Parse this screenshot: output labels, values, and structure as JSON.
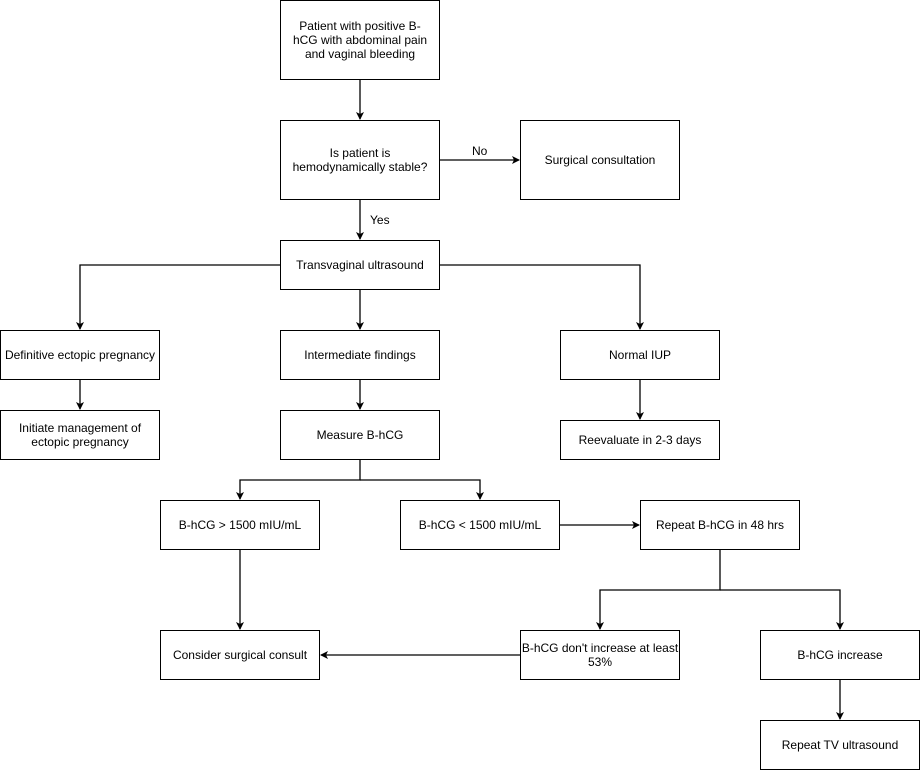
{
  "diagram": {
    "nodes": [
      {
        "id": "n1",
        "label": "Patient with positive B-hCG with abdominal pain and vaginal bleeding"
      },
      {
        "id": "n2",
        "label": "Is patient is hemodynamically stable?"
      },
      {
        "id": "n3",
        "label": "Surgical consultation"
      },
      {
        "id": "n4",
        "label": "Transvaginal ultrasound"
      },
      {
        "id": "n5",
        "label": "Definitive ectopic pregnancy"
      },
      {
        "id": "n6",
        "label": "Intermediate findings"
      },
      {
        "id": "n7",
        "label": "Normal IUP"
      },
      {
        "id": "n8",
        "label": "Initiate management of ectopic pregnancy"
      },
      {
        "id": "n9",
        "label": "Measure B-hCG"
      },
      {
        "id": "n10",
        "label": "Reevaluate in 2-3 days"
      },
      {
        "id": "n11",
        "label": "B-hCG > 1500 mIU/mL"
      },
      {
        "id": "n12",
        "label": "B-hCG < 1500 mIU/mL"
      },
      {
        "id": "n13",
        "label": "Repeat B-hCG in 48 hrs"
      },
      {
        "id": "n14",
        "label": "Consider surgical consult"
      },
      {
        "id": "n15",
        "label": "B-hCG don't increase at least 53%"
      },
      {
        "id": "n16",
        "label": "B-hCG increase"
      },
      {
        "id": "n17",
        "label": "Repeat TV ultrasound"
      }
    ],
    "edges": [
      {
        "from": "n1",
        "to": "n2",
        "label": ""
      },
      {
        "from": "n2",
        "to": "n3",
        "label": "No"
      },
      {
        "from": "n2",
        "to": "n4",
        "label": "Yes"
      },
      {
        "from": "n4",
        "to": "n5",
        "label": ""
      },
      {
        "from": "n4",
        "to": "n6",
        "label": ""
      },
      {
        "from": "n4",
        "to": "n7",
        "label": ""
      },
      {
        "from": "n5",
        "to": "n8",
        "label": ""
      },
      {
        "from": "n6",
        "to": "n9",
        "label": ""
      },
      {
        "from": "n7",
        "to": "n10",
        "label": ""
      },
      {
        "from": "n9",
        "to": "n11",
        "label": ""
      },
      {
        "from": "n9",
        "to": "n12",
        "label": ""
      },
      {
        "from": "n12",
        "to": "n13",
        "label": ""
      },
      {
        "from": "n11",
        "to": "n14",
        "label": ""
      },
      {
        "from": "n13",
        "to": "n15",
        "label": ""
      },
      {
        "from": "n13",
        "to": "n16",
        "label": ""
      },
      {
        "from": "n15",
        "to": "n14",
        "label": ""
      },
      {
        "from": "n16",
        "to": "n17",
        "label": ""
      }
    ],
    "edge_labels": {
      "no": "No",
      "yes": "Yes"
    }
  }
}
